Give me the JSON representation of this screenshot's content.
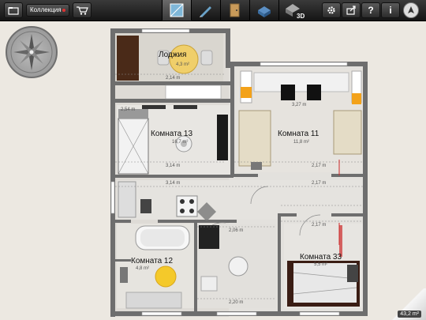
{
  "toolbar": {
    "collection_label": "Коллекция",
    "mode_3d_label": "3D"
  },
  "rooms": {
    "loggia": {
      "name": "Лоджия",
      "area": "4,3 m²"
    },
    "room13": {
      "name": "Комната 13",
      "area": "16,7 m²"
    },
    "room11": {
      "name": "Комната 11",
      "area": "11,8 m²"
    },
    "room12": {
      "name": "Комната 12",
      "area": "4,8 m²"
    },
    "room33": {
      "name": "Комната 33",
      "area": "5,5 m²"
    }
  },
  "total_area": "43,2 m²",
  "dimensions": {
    "d1": "2,14 m",
    "d2": "3,14 m",
    "d3": "3,14 m",
    "d4": "2,17 m",
    "d5": "2,17 m",
    "d6": "2,17 m",
    "d7": "2,06 m",
    "d8": "2,20 m",
    "d9": "3,27 m",
    "d10": "2,54 m"
  },
  "colors": {
    "wall": "#6e6e6e",
    "floor": "#e2e0dc",
    "accent_red": "#cc2a2a",
    "toolbar": "#1f1f1f"
  },
  "icons": [
    "folder-icon",
    "cart-icon",
    "plan-2d-icon",
    "pencil-icon",
    "door-icon",
    "furniture-icon",
    "view-3d-icon",
    "settings-icon",
    "share-icon",
    "help-icon",
    "info-icon",
    "compass-north-icon"
  ]
}
